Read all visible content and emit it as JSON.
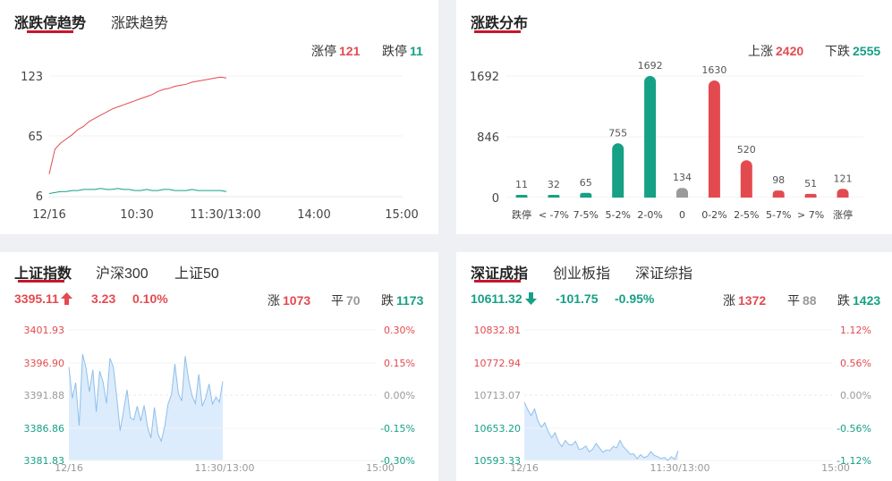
{
  "trend_panel": {
    "tabs": [
      {
        "label": "涨跌停趋势",
        "active": true
      },
      {
        "label": "涨跌趋势",
        "active": false
      }
    ],
    "limit_up_label": "涨停",
    "limit_up": "121",
    "limit_down_label": "跌停",
    "limit_down": "11",
    "y_ticks": [
      "123",
      "65",
      "6"
    ],
    "x_ticks": [
      "12/16",
      "10:30",
      "11:30/13:00",
      "14:00",
      "15:00"
    ]
  },
  "dist_panel": {
    "tabs": [
      {
        "label": "涨跌分布",
        "active": true
      }
    ],
    "up_label": "上涨",
    "up": "2420",
    "down_label": "下跌",
    "down": "2555",
    "y_ticks": [
      "1692",
      "846",
      "0"
    ]
  },
  "sh_panel": {
    "tabs": [
      {
        "label": "上证指数",
        "active": true
      },
      {
        "label": "沪深300",
        "active": false
      },
      {
        "label": "上证50",
        "active": false
      }
    ],
    "price": "3395.11",
    "change": "3.23",
    "pct": "0.10%",
    "direction": "up",
    "rise_label": "涨",
    "rise": "1073",
    "flat_label": "平",
    "flat": "70",
    "fall_label": "跌",
    "fall": "1173",
    "y_left": [
      "3401.93",
      "3396.90",
      "3391.88",
      "3386.86",
      "3381.83"
    ],
    "y_right": [
      "0.30%",
      "0.15%",
      "0.00%",
      "-0.15%",
      "-0.30%"
    ],
    "x_ticks": [
      "12/16",
      "11:30/13:00",
      "15:00"
    ]
  },
  "sz_panel": {
    "tabs": [
      {
        "label": "深证成指",
        "active": true
      },
      {
        "label": "创业板指",
        "active": false
      },
      {
        "label": "深证综指",
        "active": false
      }
    ],
    "price": "10611.32",
    "change": "-101.75",
    "pct": "-0.95%",
    "direction": "down",
    "rise_label": "涨",
    "rise": "1372",
    "flat_label": "平",
    "flat": "88",
    "fall_label": "跌",
    "fall": "1423",
    "y_left": [
      "10832.81",
      "10772.94",
      "10713.07",
      "10653.20",
      "10593.33"
    ],
    "y_right": [
      "1.12%",
      "0.56%",
      "0.00%",
      "-0.56%",
      "-1.12%"
    ],
    "x_ticks": [
      "12/16",
      "11:30/13:00",
      "15:00"
    ]
  },
  "colors": {
    "up": "#e34a4f",
    "down": "#16a085",
    "flat": "#9a9a9a",
    "accent": "#c8152d",
    "area": "#dcecfc",
    "area_line": "#8fbfea"
  },
  "chart_data": [
    {
      "type": "line",
      "title": "涨跌停趋势",
      "ylim": [
        6,
        123
      ],
      "series": [
        {
          "name": "涨停",
          "values": [
            28,
            52,
            58,
            62,
            66,
            71,
            74,
            79,
            82,
            85,
            88,
            91,
            93,
            95,
            97,
            99,
            101,
            103,
            105,
            108,
            110,
            111,
            113,
            114,
            115,
            117,
            118,
            119,
            120,
            121,
            122,
            121
          ]
        },
        {
          "name": "跌停",
          "values": [
            9,
            10,
            11,
            11,
            12,
            12,
            13,
            13,
            13,
            14,
            13,
            13,
            14,
            13,
            13,
            12,
            12,
            13,
            12,
            12,
            13,
            13,
            12,
            12,
            12,
            13,
            12,
            12,
            12,
            12,
            12,
            11
          ]
        }
      ]
    },
    {
      "type": "bar",
      "title": "涨跌分布",
      "categories": [
        "跌停",
        "< -7%",
        "7-5%",
        "5-2%",
        "2-0%",
        "0",
        "0-2%",
        "2-5%",
        "5-7%",
        "> 7%",
        "涨停"
      ],
      "values": [
        11,
        32,
        65,
        755,
        1692,
        134,
        1630,
        520,
        98,
        51,
        121
      ],
      "ylim": [
        0,
        1692
      ]
    },
    {
      "type": "area",
      "title": "上证指数",
      "ylim": [
        3381.83,
        3401.93
      ],
      "values": [
        3396.2,
        3391.4,
        3393.8,
        3387.2,
        3398.2,
        3396.1,
        3392.4,
        3395.8,
        3389.3,
        3395.6,
        3393.9,
        3390.6,
        3397.6,
        3396.2,
        3391.6,
        3386.4,
        3389.6,
        3392.7,
        3388.4,
        3388.1,
        3390.2,
        3387.9,
        3390.3,
        3387.0,
        3385.3,
        3390.0,
        3386.0,
        3384.8,
        3387.0,
        3390.5,
        3392.0,
        3396.7,
        3392.2,
        3391.0,
        3397.9,
        3394.3,
        3391.8,
        3390.6,
        3395.1,
        3390.2,
        3391.5,
        3393.6,
        3390.5,
        3391.6,
        3390.8,
        3394.0
      ]
    },
    {
      "type": "area",
      "title": "深证成指",
      "ylim": [
        10593.33,
        10832.81
      ],
      "values": [
        10700.5,
        10686.9,
        10675.6,
        10687.8,
        10665.7,
        10654.3,
        10662.5,
        10646.1,
        10634.8,
        10644.2,
        10627.4,
        10618.6,
        10630.0,
        10622.4,
        10621.7,
        10628.6,
        10613.5,
        10615.2,
        10619.8,
        10609.1,
        10613.8,
        10624.7,
        10616.2,
        10608.4,
        10612.3,
        10611.6,
        10619.1,
        10616.7,
        10630.0,
        10618.5,
        10611.8,
        10604.7,
        10605.5,
        10596.6,
        10604.0,
        10598.4,
        10600.8,
        10609.8,
        10602.9,
        10600.3,
        10596.9,
        10598.8,
        10593.4,
        10600.1,
        10595.5,
        10611.3
      ]
    }
  ]
}
